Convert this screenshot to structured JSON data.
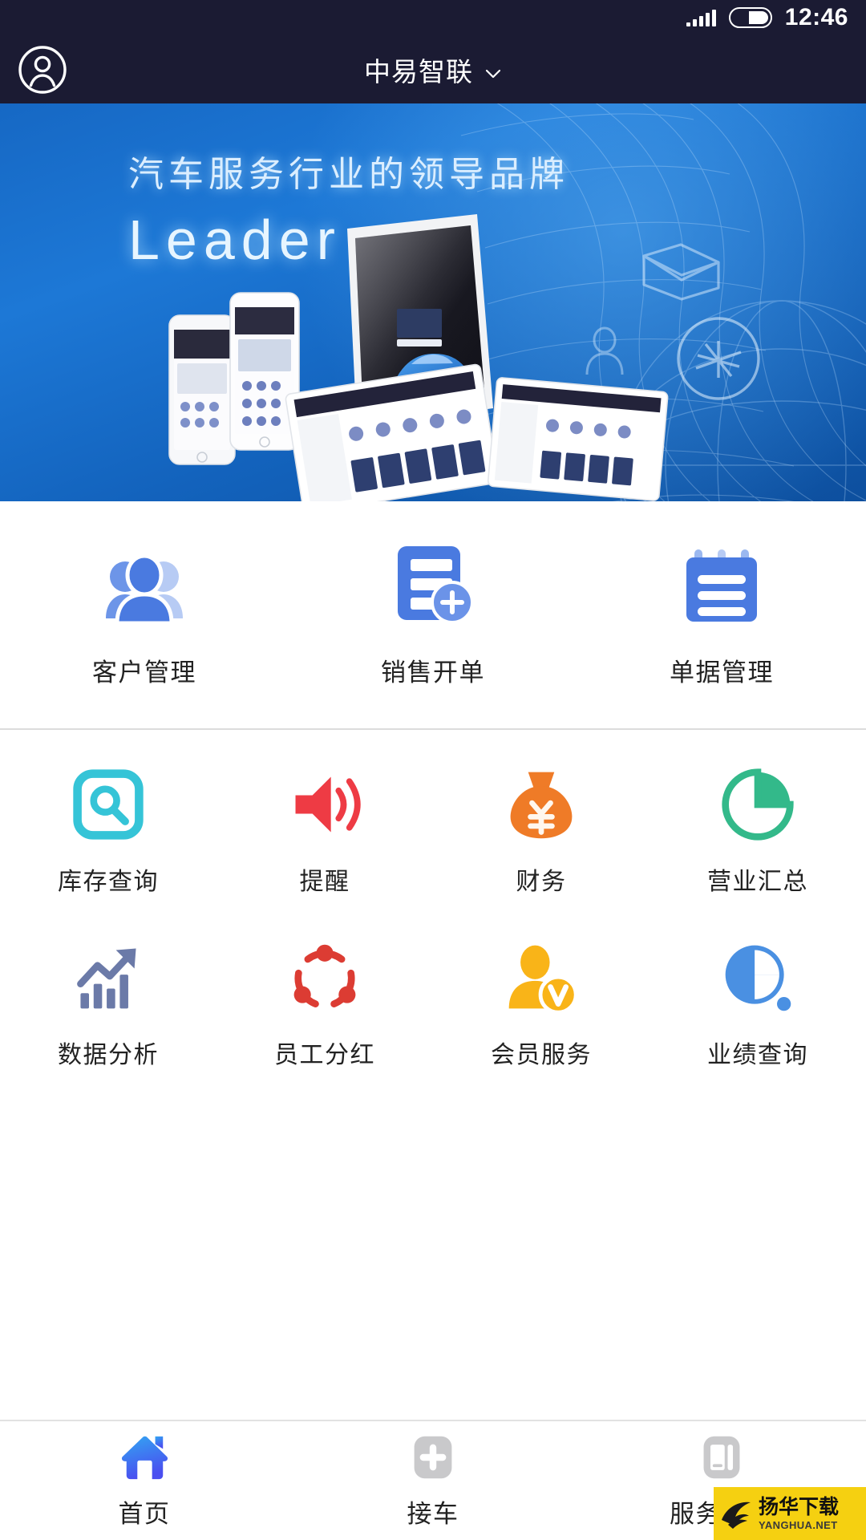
{
  "status_bar": {
    "time": "12:46",
    "signal_icon": "signal-bars-icon",
    "battery_icon": "battery-icon"
  },
  "header": {
    "avatar_icon": "user-avatar-icon",
    "title": "中易智联",
    "dropdown_icon": "chevron-down-icon"
  },
  "banner": {
    "headline_cn": "汽车服务行业的领导品牌",
    "headline_en": "Leader",
    "decor_icons": [
      "mail-envelope-icon",
      "person-outline-icon",
      "network-circle-icon",
      "wireframe-mesh",
      "wireframe-globe"
    ],
    "illustration": "devices-showcase-image"
  },
  "primary_actions": [
    {
      "label": "客户管理",
      "icon": "customer-group-icon",
      "color": "#4a7ae0"
    },
    {
      "label": "销售开单",
      "icon": "sales-order-add-icon",
      "color": "#4a7ae0"
    },
    {
      "label": "单据管理",
      "icon": "document-notepad-icon",
      "color": "#4a7ae0"
    }
  ],
  "feature_actions": [
    {
      "label": "库存查询",
      "icon": "inventory-search-icon",
      "color": "#35c4d7"
    },
    {
      "label": "提醒",
      "icon": "speaker-reminder-icon",
      "color": "#ee3b44"
    },
    {
      "label": "财务",
      "icon": "money-bag-yuan-icon",
      "color": "#ef7b27"
    },
    {
      "label": "营业汇总",
      "icon": "pie-chart-icon",
      "color": "#33b98a"
    },
    {
      "label": "数据分析",
      "icon": "bar-chart-trend-icon",
      "color": "#6b7aa8"
    },
    {
      "label": "员工分红",
      "icon": "share-network-icon",
      "color": "#dc3c33"
    },
    {
      "label": "会员服务",
      "icon": "member-vip-icon",
      "color": "#f9b418"
    },
    {
      "label": "业绩查询",
      "icon": "performance-pie-icon",
      "color": "#4a90e2"
    }
  ],
  "tabbar": [
    {
      "label": "首页",
      "icon": "home-icon",
      "active": true
    },
    {
      "label": "接车",
      "icon": "plus-square-icon",
      "active": false
    },
    {
      "label": "服务内参",
      "icon": "book-icon",
      "active": false
    }
  ],
  "watermark": {
    "cn": "扬华下载",
    "en": "YANGHUA.NET",
    "logo_icon": "yanghua-bird-logo-icon",
    "bg_color": "#f5d011"
  },
  "colors": {
    "header_bg": "#1b1b33",
    "banner_blue": "#1668c4",
    "primary_blue": "#4a7ae0",
    "text_dark": "#222222",
    "divider": "#dcdcdc"
  }
}
